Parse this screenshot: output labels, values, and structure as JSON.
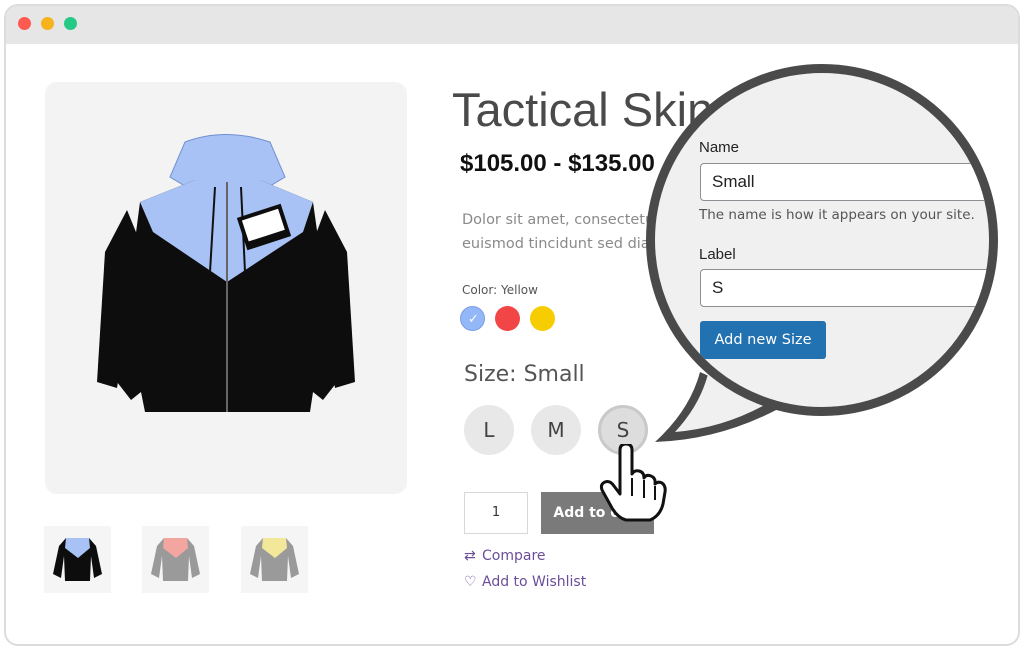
{
  "window": {
    "colors": {
      "close": "#ff5a52",
      "minimize": "#f6b31d",
      "maximize": "#24c986"
    }
  },
  "product": {
    "title": "Tactical Skin",
    "price": "$105.00 - $135.00",
    "description_lines": [
      "Dolor sit amet, consectetur",
      "euismod tincidunt sed diam"
    ],
    "color": {
      "label": "Color:",
      "value": "Yellow",
      "swatches": [
        "#93b7f7",
        "#f24646",
        "#f6cd00"
      ],
      "selected_index": 0
    },
    "size": {
      "label": "Size: Small",
      "options": [
        "L",
        "M",
        "S"
      ],
      "selected": "S"
    },
    "quantity": "1",
    "add_to_cart": "Add to cart",
    "compare": "Compare",
    "wishlist": "Add to Wishlist",
    "thumbnails": [
      "blue-hoodie",
      "red-hoodie",
      "yellow-hoodie"
    ]
  },
  "callout": {
    "name_label": "Name",
    "name_value": "Small",
    "name_hint": "The name is how it appears on your site.",
    "label_label": "Label",
    "label_value": "S",
    "button": "Add new Size",
    "button_color": "#2271b1"
  }
}
